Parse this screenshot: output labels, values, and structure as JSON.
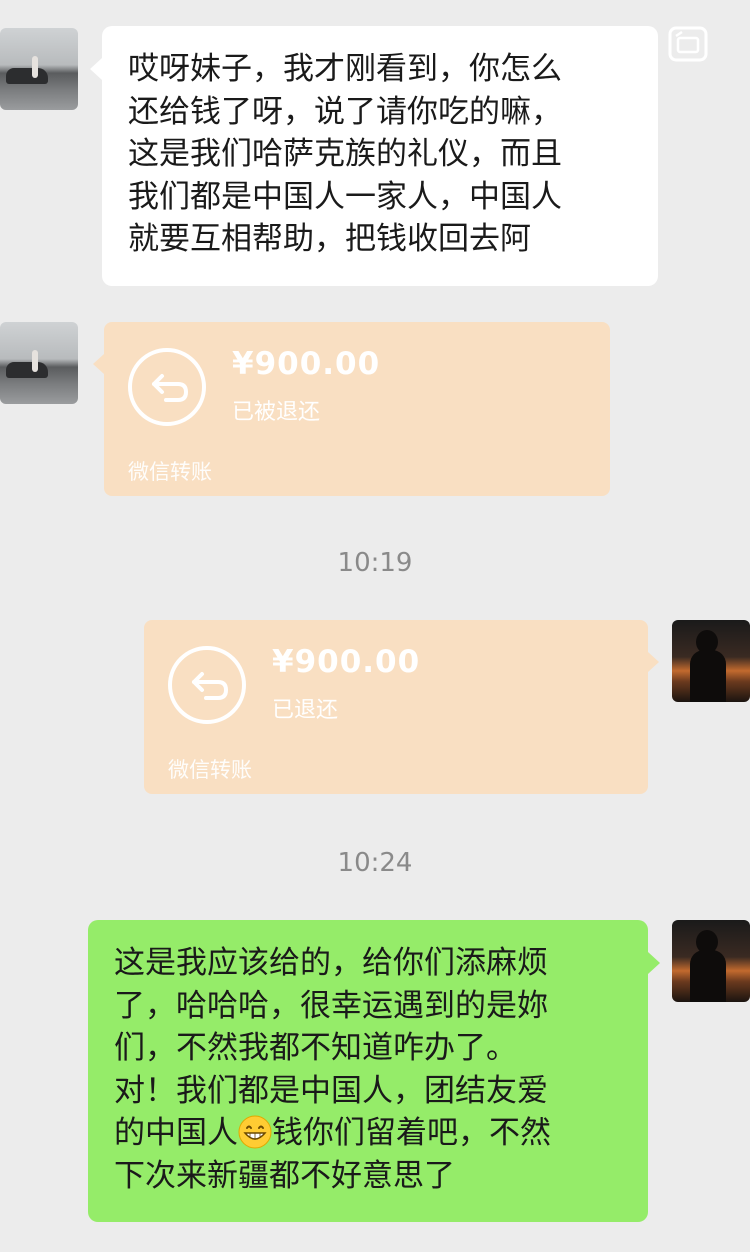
{
  "messages": {
    "msg1": {
      "lines": [
        "哎呀妹子，我才刚看到，你怎么",
        "还给钱了呀，说了请你吃的嘛，",
        "这是我们哈萨克族的礼仪，而且",
        "我们都是中国人一家人，中国人",
        "就要互相帮助，把钱收回去阿"
      ]
    },
    "transfer1": {
      "amount": "¥900.00",
      "status": "已被退还",
      "footer": "微信转账"
    },
    "time1": "10:19",
    "transfer2": {
      "amount": "¥900.00",
      "status": "已退还",
      "footer": "微信转账"
    },
    "time2": "10:24",
    "msg2": {
      "lines": [
        "这是我应该给的，给你们添麻烦",
        "了，哈哈哈，很幸运遇到的是妳",
        "们，不然我都不知道咋办了。",
        "对！我们都是中国人，团结友爱"
      ],
      "line5_before": "的中国人",
      "line5_emoji": "grinning-face-emoji",
      "line5_after": "钱你们留着吧，不然",
      "line6": "下次来新疆都不好意思了"
    }
  },
  "colors": {
    "background": "#ececec",
    "incoming_bubble": "#ffffff",
    "outgoing_bubble": "#95ec69",
    "transfer_card": "#f9dfc2",
    "timestamp_text": "#8a8a8a"
  },
  "icons": {
    "top_right": "window-mode-icon",
    "transfer": "return-arrow-icon"
  }
}
